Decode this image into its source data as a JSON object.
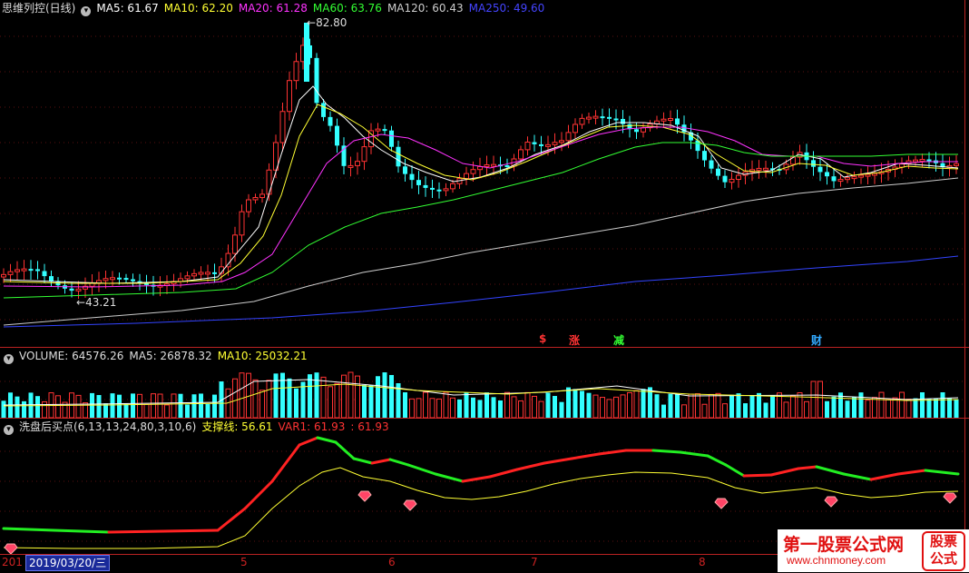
{
  "price_panel": {
    "title": "思维列控(日线)",
    "ma5": "MA5: 61.67",
    "ma10": "MA10: 62.20",
    "ma20": "MA20: 61.28",
    "ma60": "MA60: 63.76",
    "ma120": "MA120: 60.43",
    "ma250": "MA250: 49.60",
    "high_label": "82.80",
    "low_label": "43.21",
    "colors": {
      "ma5": "#ffffff",
      "ma10": "#ffff33",
      "ma20": "#ff33ff",
      "ma60": "#33ff33",
      "ma120": "#cccccc",
      "ma250": "#3344ff",
      "up": "#ff3333",
      "down": "#33ffff"
    }
  },
  "event_markers": [
    {
      "text": "$",
      "color": "#ff3333"
    },
    {
      "text": "涨",
      "color": "#ff3333"
    },
    {
      "text": "减",
      "color": "#33ff33"
    },
    {
      "text": "财",
      "color": "#33aaff"
    }
  ],
  "volume_panel": {
    "title": "VOLUME: 64576.26",
    "ma5": "MA5: 26878.32",
    "ma10": "MA10: 25032.21"
  },
  "indicator_panel": {
    "title": "洗盘后买点(6,13,13,24,80,3,10,6)",
    "support": "支撑线: 56.61",
    "var1": "VAR1: 61.93",
    "var1b": ": 61.93"
  },
  "time_axis": {
    "cursor_date": "2019/03/20/三",
    "left_fragment": "201",
    "months": [
      "5",
      "6",
      "7",
      "8"
    ]
  },
  "watermark": {
    "title": "第一股票公式网",
    "url": "www.chnmoney.com",
    "badge": "股票公式"
  }
}
